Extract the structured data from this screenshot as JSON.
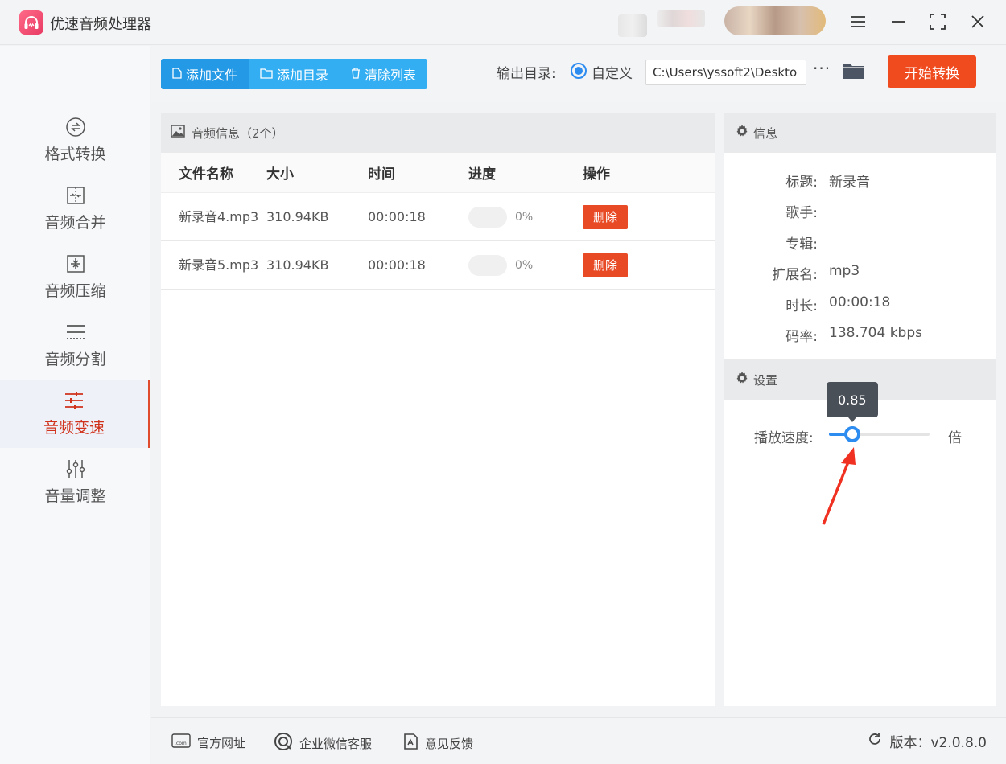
{
  "app": {
    "title": "优速音频处理器",
    "logo_icon": "headphones-icon"
  },
  "window_controls": [
    "menu-icon",
    "minimize-icon",
    "maximize-icon",
    "close-icon"
  ],
  "sidebar": {
    "items": [
      {
        "label": "格式转换",
        "icon": "format-convert-icon",
        "active": false
      },
      {
        "label": "音频合并",
        "icon": "merge-icon",
        "active": false
      },
      {
        "label": "音频压缩",
        "icon": "compress-icon",
        "active": false
      },
      {
        "label": "音频分割",
        "icon": "split-icon",
        "active": false
      },
      {
        "label": "音频变速",
        "icon": "speed-sliders-icon",
        "active": true
      },
      {
        "label": "音量调整",
        "icon": "volume-sliders-icon",
        "active": false
      }
    ]
  },
  "toolbar": {
    "add_file": "添加文件",
    "add_folder": "添加目录",
    "clear_list": "清除列表",
    "output_label": "输出目录:",
    "custom_option": "自定义",
    "output_path": "C:\\Users\\yssoft2\\Deskto",
    "more": "···",
    "start": "开始转换"
  },
  "file_panel": {
    "title": "音频信息（2个）",
    "columns": [
      "文件名称",
      "大小",
      "时间",
      "进度",
      "操作"
    ],
    "rows": [
      {
        "name": "新录音4.mp3",
        "size": "310.94KB",
        "duration": "00:00:18",
        "progress": 0,
        "progress_text": "0%",
        "action": "删除"
      },
      {
        "name": "新录音5.mp3",
        "size": "310.94KB",
        "duration": "00:00:18",
        "progress": 0,
        "progress_text": "0%",
        "action": "删除"
      }
    ]
  },
  "info_panel": {
    "title": "信息",
    "fields": [
      {
        "key": "标题:",
        "value": "新录音"
      },
      {
        "key": "歌手:",
        "value": ""
      },
      {
        "key": "专辑:",
        "value": ""
      },
      {
        "key": "扩展名:",
        "value": "mp3"
      },
      {
        "key": "时长:",
        "value": "00:00:18"
      },
      {
        "key": "码率:",
        "value": "138.704 kbps"
      }
    ]
  },
  "settings_panel": {
    "title": "设置",
    "speed_label": "播放速度:",
    "speed_value": "0.85",
    "speed_fraction": 0.23,
    "speed_unit": "倍"
  },
  "footer": {
    "website": "官方网址",
    "wechat": "企业微信客服",
    "feedback": "意见反馈",
    "version": "版本：v2.0.8.0"
  },
  "colors": {
    "accent": "#2d8cf0",
    "danger": "#f04b1f",
    "active_nav": "#d0321c",
    "toolbar_blue": "#34aef2"
  }
}
